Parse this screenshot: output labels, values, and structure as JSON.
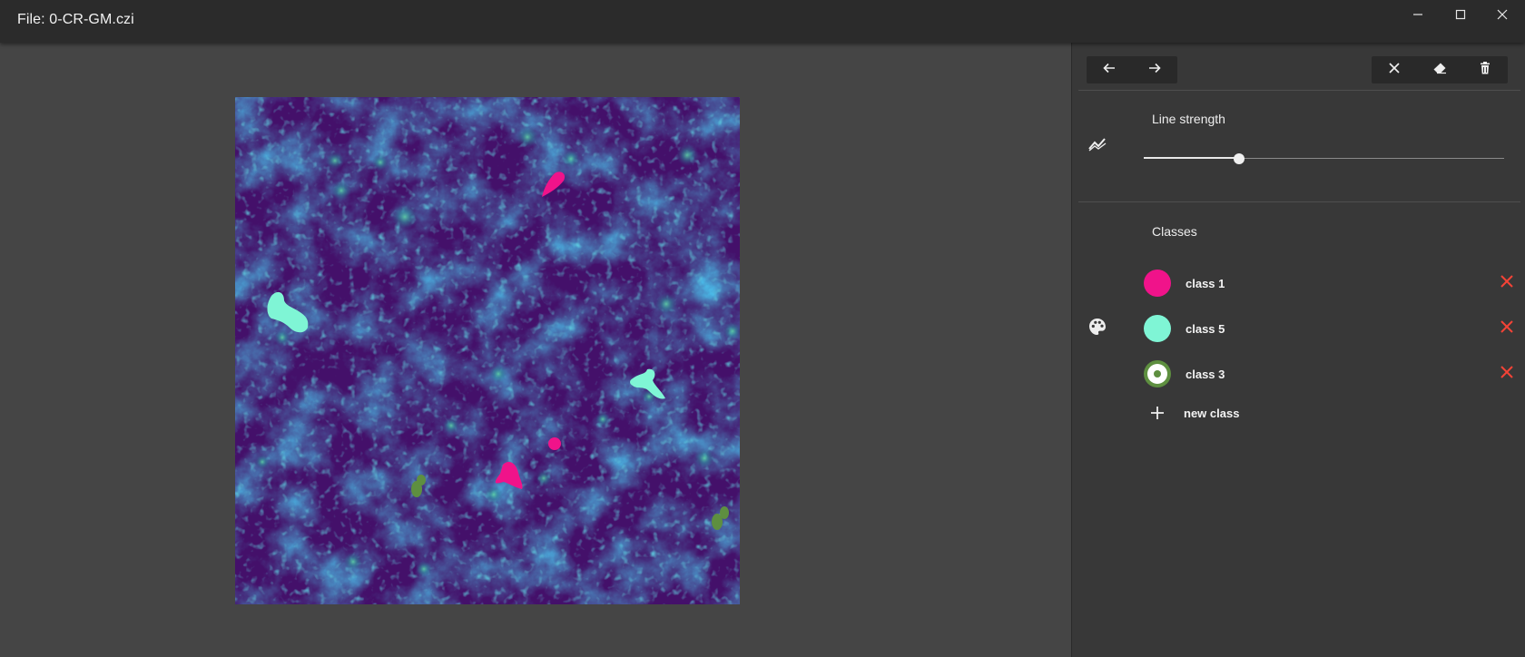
{
  "window": {
    "title": "File: 0-CR-GM.czi",
    "controls": [
      "minimize-icon",
      "maximize-icon",
      "close-icon"
    ]
  },
  "toolbar": {
    "history": [
      "undo-arrow-icon",
      "redo-arrow-icon"
    ],
    "actions": [
      "clear-icon",
      "eraser-icon",
      "delete-icon"
    ]
  },
  "line_strength": {
    "label": "Line strength",
    "icon": "line-chart-icon",
    "value_fraction": 0.265
  },
  "classes": {
    "label": "Classes",
    "icon": "palette-icon",
    "items": [
      {
        "name": "class 1",
        "color": "#f0138a",
        "selected": false
      },
      {
        "name": "class 5",
        "color": "#7ff5d5",
        "selected": false
      },
      {
        "name": "class 3",
        "color": "#5e8f40",
        "selected": true
      }
    ],
    "remove_color": "#f44336",
    "new_label": "new class"
  },
  "image": {
    "background": "#44106a",
    "annotation_colors": [
      "#f0138a",
      "#7ff5d5",
      "#5e8f40"
    ]
  }
}
